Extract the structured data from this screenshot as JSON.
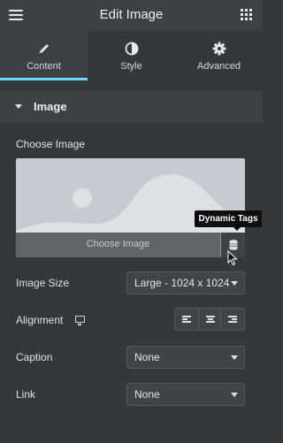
{
  "header": {
    "title": "Edit Image",
    "menu_icon": "hamburger-icon",
    "apps_icon": "grid-icon"
  },
  "tabs": [
    {
      "label": "Content",
      "icon": "pencil-icon",
      "active": true
    },
    {
      "label": "Style",
      "icon": "half-circle-icon",
      "active": false
    },
    {
      "label": "Advanced",
      "icon": "gear-icon",
      "active": false
    }
  ],
  "section": {
    "title": "Image"
  },
  "image_control": {
    "label": "Choose Image",
    "button_label": "Choose Image",
    "dynamic_icon": "database-icon"
  },
  "tooltip": {
    "text": "Dynamic Tags"
  },
  "image_size": {
    "label": "Image Size",
    "value": "Large - 1024 x 1024"
  },
  "alignment": {
    "label": "Alignment",
    "device_icon": "monitor-icon",
    "options": [
      "align-left-icon",
      "align-center-icon",
      "align-right-icon"
    ]
  },
  "caption": {
    "label": "Caption",
    "value": "None"
  },
  "link": {
    "label": "Link",
    "value": "None"
  },
  "colors": {
    "accent": "#71d7f7",
    "background": "#34383c",
    "panel": "#3d4146"
  }
}
